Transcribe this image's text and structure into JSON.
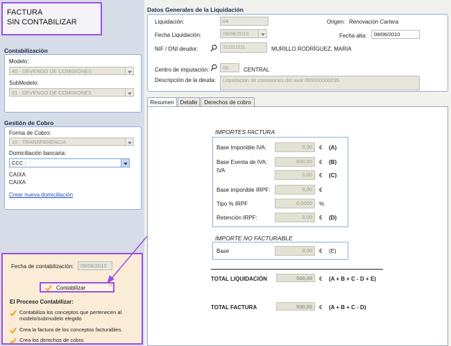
{
  "header": {
    "line1": "FACTURA",
    "line2": "SIN CONTABILIZAR"
  },
  "contabilizacion": {
    "title": "Contabilización",
    "modelo_label": "Modelo:",
    "modelo_value": "40 - DEVENGO DE COMISIONES",
    "submodelo_label": "SubModelo:",
    "submodelo_value": "01 - DEVENGO DE COMISIONES"
  },
  "gestion": {
    "title": "Gestión de Cobro",
    "forma_label": "Forma de Cobro:",
    "forma_value": "10 - TRANSFERENCIA",
    "domiciliacion_label": "Domiciliación bancaria:",
    "domiciliacion_value": "CCC :",
    "bank1": "CAIXA",
    "bank2": "CAIXA",
    "crear_link": "Crear nueva domiciliación"
  },
  "contabilizar_panel": {
    "fecha_label": "Fecha de contabilización:",
    "fecha_value": "09/06/2010",
    "button_label": "Contabilizar",
    "proceso_title": "El Proceso Contabilizar:",
    "step1": "Contabiliza los conceptos que pertenecen al modelo/submodelo elegido",
    "step2": "Crea la factura de los conceptos facturables.",
    "step3": "Crea los derechos de cobro."
  },
  "datos": {
    "title": "Datos Generales de la Liquidación",
    "liquidacion_label": "Liquidación:",
    "liquidacion_value": "84",
    "origen_label": "Origen:",
    "origen_value": "Renovación Cartera",
    "fecha_liq_label": "Fecha Liquidación:",
    "fecha_liq_value": "09/06/2010",
    "fecha_alta_label": "Fecha alta:",
    "fecha_alta_value": "09/06/2010",
    "nif_label": "NIF / DNI deudor:",
    "nif_value": "11111111L",
    "nif_name": "MURILLO RODRÍGUEZ, MARIA",
    "centro_label": "Centro de imputación:",
    "centro_value": "00",
    "centro_name": "CENTRAL",
    "descripcion_label": "Descripción de la deuda:",
    "descripcion_value": "Liquidación de comisiones del aval 000000000035"
  },
  "tabs": [
    "Resumen",
    "Detalle",
    "Derechos de cobro"
  ],
  "importes": {
    "title": "IMPORTES FACTURA",
    "rows": [
      {
        "label": "Base Imponible IVA:",
        "value": "0,00",
        "unit": "€",
        "code": "(A)"
      },
      {
        "label": "Base Exenta de IVA:",
        "value": "500,00",
        "unit": "€",
        "code": "(B)"
      },
      {
        "label": "IVA",
        "value": "0,00",
        "unit": "€",
        "code": "(C)"
      },
      {
        "label": "Base imponible IRPF:",
        "value": "0,00",
        "unit": "€",
        "code": ""
      },
      {
        "label": "Tipo % IRPF",
        "value": "0,0000",
        "unit": "%",
        "code": ""
      },
      {
        "label": "Retención IRPF:",
        "value": "0,00",
        "unit": "€",
        "code": "(D)"
      }
    ]
  },
  "no_facturable": {
    "title": "IMPORTE NO FACTURABLE",
    "label": "Base",
    "value": "0,00",
    "unit": "€",
    "code": "(E)"
  },
  "totals": {
    "liq_label": "TOTAL LIQUIDACIÓN",
    "liq_value": "500,00",
    "liq_unit": "€",
    "liq_formula": "(A + B + C - D + E)",
    "fact_label": "TOTAL FACTURA",
    "fact_value": "500,00",
    "fact_unit": "€",
    "fact_formula": "(A + B + C - D)"
  },
  "colors": {
    "highlight": "#9a4ee6",
    "left_bg": "#d6dce8",
    "link": "#1f4fb5"
  }
}
